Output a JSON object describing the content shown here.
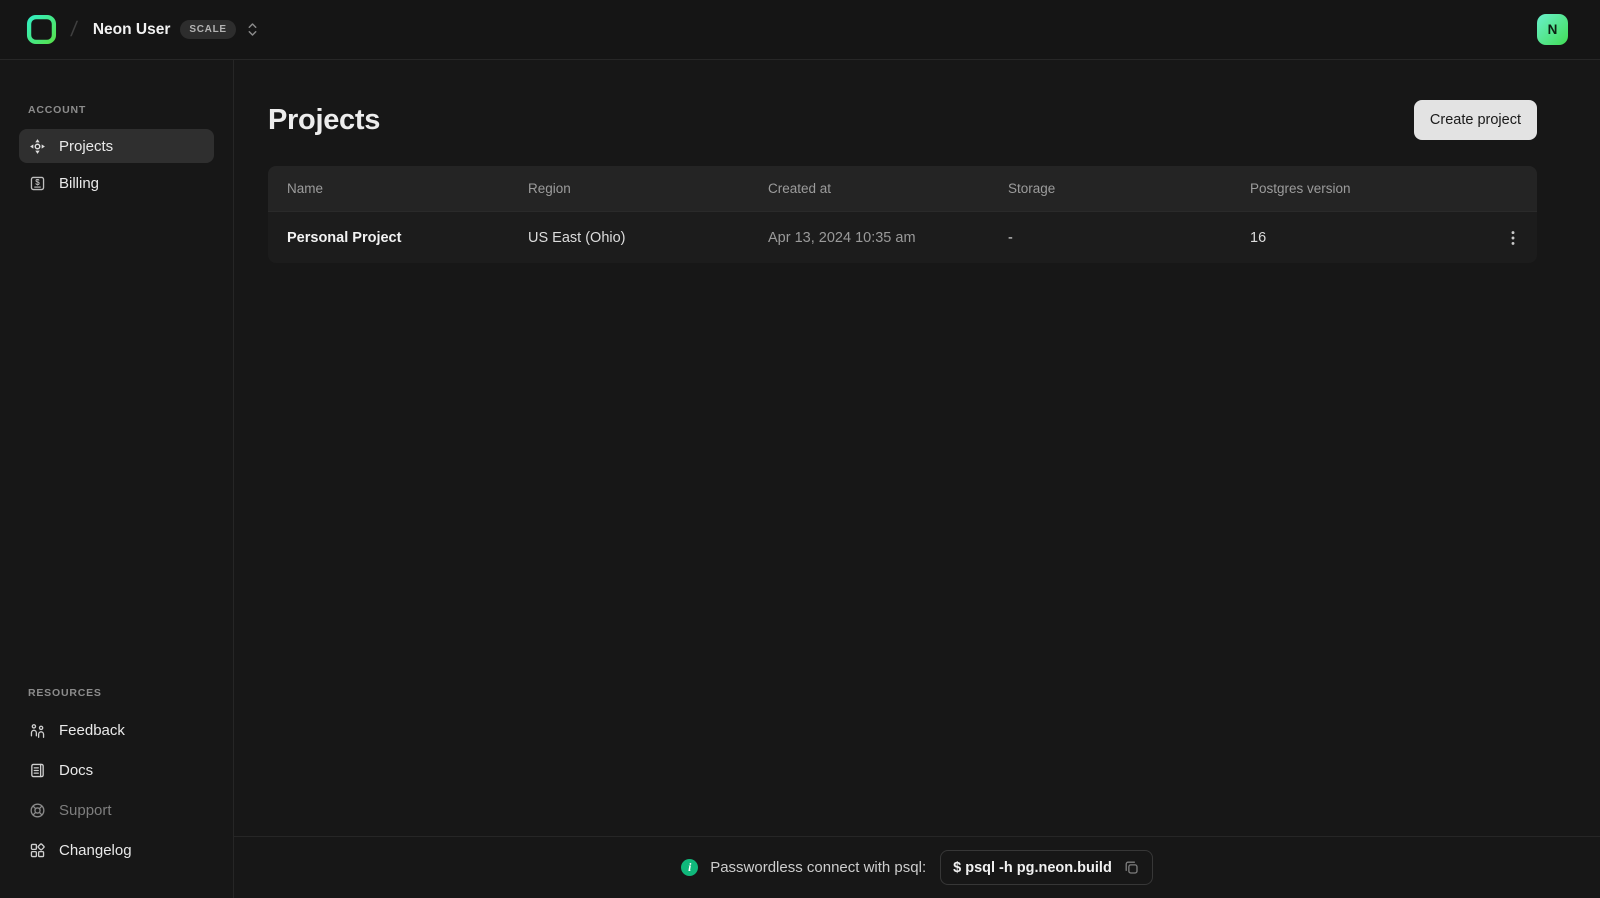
{
  "colors": {
    "accent_green": "#00e599",
    "info_icon_green": "#10b87b",
    "topbar_bg": "#151515",
    "table_header_bg": "#242424",
    "create_button_bg": "#e3e3e3"
  },
  "header": {
    "logo_icon": "neon-logo-icon",
    "org_name": "Neon User",
    "plan_badge": "SCALE",
    "org_switcher_icon": "chevron-up-down-icon",
    "avatar_initial": "N"
  },
  "sidebar": {
    "account_section_label": "ACCOUNT",
    "account_items": [
      {
        "label": "Projects",
        "icon": "projects-icon",
        "active": true
      },
      {
        "label": "Billing",
        "icon": "billing-icon",
        "active": false
      }
    ],
    "resources_section_label": "RESOURCES",
    "resource_items": [
      {
        "label": "Feedback",
        "icon": "feedback-icon",
        "dimmed": false
      },
      {
        "label": "Docs",
        "icon": "docs-icon",
        "dimmed": false
      },
      {
        "label": "Support",
        "icon": "support-icon",
        "dimmed": true
      },
      {
        "label": "Changelog",
        "icon": "changelog-icon",
        "dimmed": false
      }
    ]
  },
  "main": {
    "page_title": "Projects",
    "create_button_label": "Create project",
    "table": {
      "columns": [
        "Name",
        "Region",
        "Created at",
        "Storage",
        "Postgres version"
      ],
      "rows": [
        {
          "name": "Personal Project",
          "region": "US East (Ohio)",
          "created_at": "Apr 13, 2024 10:35 am",
          "storage": "-",
          "postgres_version": "16"
        }
      ]
    }
  },
  "footer": {
    "info_text": "Passwordless connect with psql:",
    "command": "$ psql -h pg.neon.build"
  }
}
